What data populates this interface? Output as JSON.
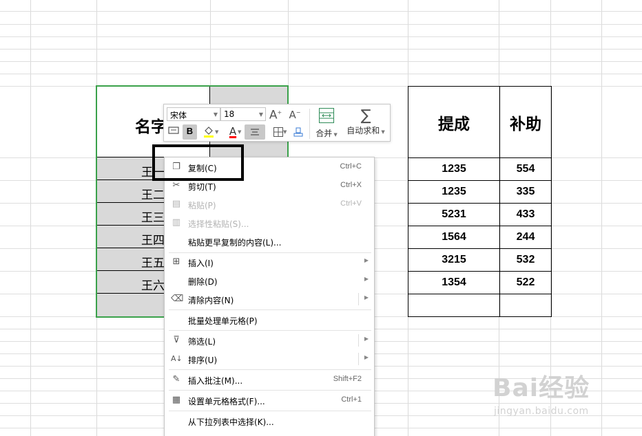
{
  "left_table": {
    "header": "名字",
    "names": [
      "王一",
      "王二",
      "王三",
      "王四",
      "王五",
      "王六"
    ]
  },
  "right_table": {
    "headers": [
      "提成",
      "补助"
    ],
    "rows": [
      [
        "1235",
        "554"
      ],
      [
        "1235",
        "335"
      ],
      [
        "5231",
        "433"
      ],
      [
        "1564",
        "244"
      ],
      [
        "3215",
        "532"
      ],
      [
        "1354",
        "522"
      ],
      [
        "",
        ""
      ]
    ]
  },
  "toolbar": {
    "font_name": "宋体",
    "font_size": "18",
    "increase_font": "A",
    "decrease_font": "A",
    "bold": "B",
    "merge_label": "合并",
    "autosum_label": "自动求和",
    "colors": {
      "highlight": "#ffff00",
      "font_color": "#ff0000"
    }
  },
  "context_menu": {
    "items": [
      {
        "label": "复制(C)",
        "shortcut": "Ctrl+C",
        "icon": "copy-icon"
      },
      {
        "label": "剪切(T)",
        "shortcut": "Ctrl+X",
        "icon": "scissors-icon"
      },
      {
        "label": "粘贴(P)",
        "shortcut": "Ctrl+V",
        "icon": "paste-icon",
        "disabled": true
      },
      {
        "label": "选择性粘贴(S)...",
        "shortcut": "",
        "icon": "paste-special-icon",
        "disabled": true
      },
      {
        "label": "粘贴更早复制的内容(L)...",
        "shortcut": "",
        "icon": ""
      },
      {
        "label": "插入(I)",
        "shortcut": "",
        "icon": "insert-cells-icon",
        "submenu": true
      },
      {
        "label": "删除(D)",
        "shortcut": "",
        "icon": "",
        "submenu": true
      },
      {
        "label": "清除内容(N)",
        "shortcut": "",
        "icon": "eraser-icon",
        "submenu": true
      },
      {
        "label": "批量处理单元格(P)",
        "shortcut": "",
        "icon": ""
      },
      {
        "label": "筛选(L)",
        "shortcut": "",
        "icon": "filter-icon",
        "submenu": true
      },
      {
        "label": "排序(U)",
        "shortcut": "",
        "icon": "sort-icon",
        "submenu": true
      },
      {
        "label": "插入批注(M)...",
        "shortcut": "Shift+F2",
        "icon": "comment-icon"
      },
      {
        "label": "设置单元格格式(F)...",
        "shortcut": "Ctrl+1",
        "icon": "format-cells-icon"
      },
      {
        "label": "从下拉列表中选择(K)...",
        "shortcut": "",
        "icon": ""
      }
    ]
  },
  "watermark": {
    "brand": "Bai经验",
    "url": "jingyan.baidu.com"
  },
  "colors": {
    "selection_border": "#3aa14a",
    "selected_cell_bg": "#d9d9d9"
  }
}
